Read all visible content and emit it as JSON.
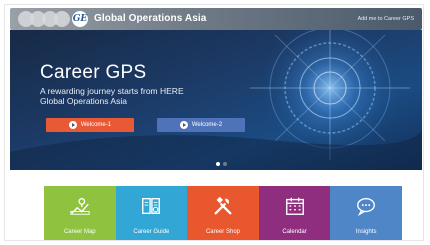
{
  "header": {
    "brand_initials": "GE",
    "brand_title": "Global Operations Asia",
    "top_link": "Add me to Career GPS"
  },
  "hero": {
    "title": "Career GPS",
    "subtitle_line1": "A rewarding journey starts from HERE",
    "subtitle_line2": "Global Operations Asia",
    "buttons": [
      {
        "label": "Welcome-1",
        "color": "#e85a36",
        "icon": "play-circle-icon"
      },
      {
        "label": "Welcome-2",
        "color": "#4f72b8",
        "icon": "play-circle-icon"
      }
    ],
    "carousel": {
      "total": 2,
      "active": 1
    }
  },
  "tiles": [
    {
      "label": "Career Map",
      "color": "#8ec23f",
      "icon": "map-icon"
    },
    {
      "label": "Career Guide",
      "color": "#32a6d4",
      "icon": "book-icon"
    },
    {
      "label": "Career Shop",
      "color": "#e8572d",
      "icon": "tools-icon"
    },
    {
      "label": "Calendar",
      "color": "#8f2e7f",
      "icon": "calendar-icon"
    },
    {
      "label": "Insights",
      "color": "#4f86c7",
      "icon": "chat-icon"
    }
  ]
}
